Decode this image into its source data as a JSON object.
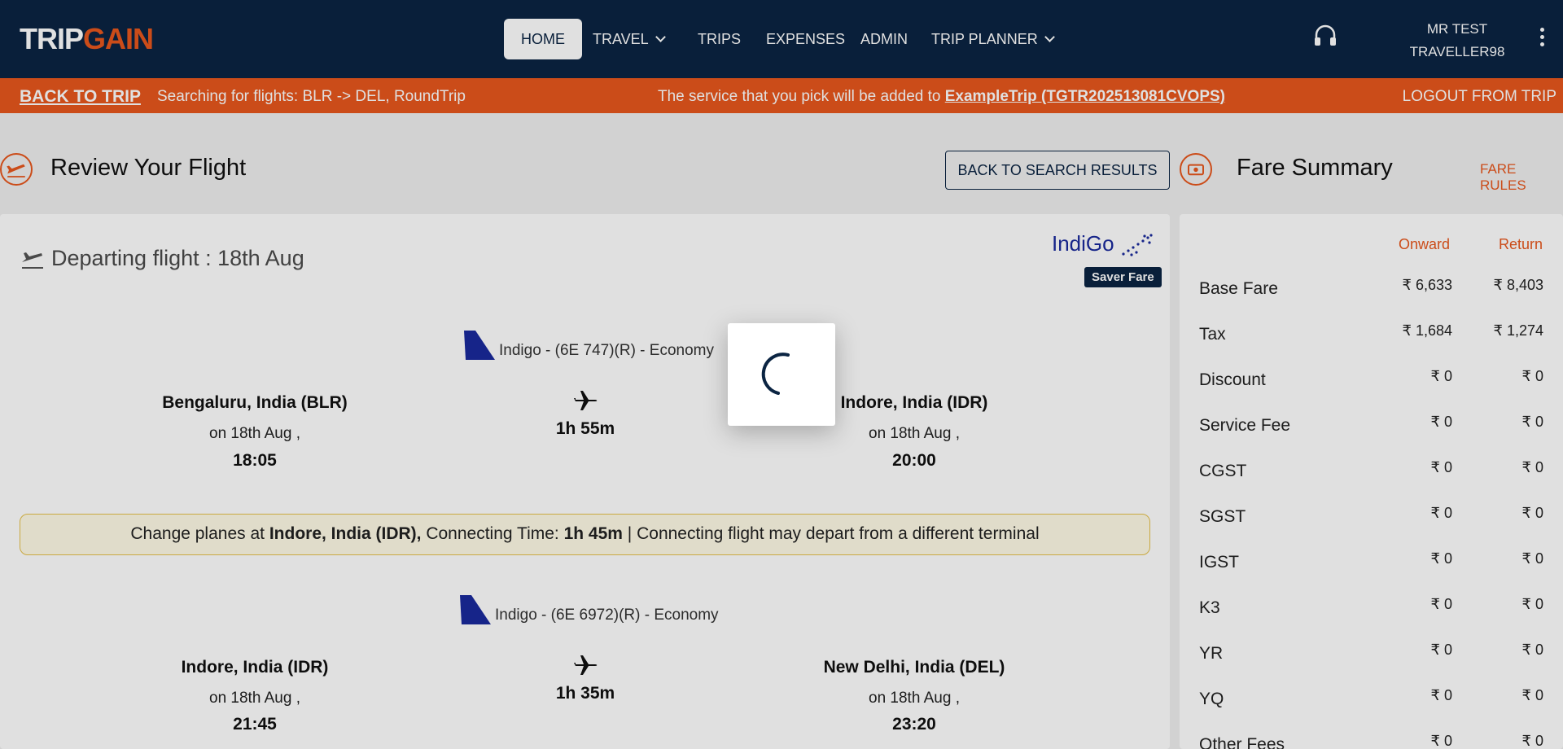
{
  "nav": {
    "logo_trip": "TRIP",
    "logo_gain": "GAIN",
    "home": "HOME",
    "travel": "TRAVEL",
    "trips": "TRIPS",
    "expenses": "EXPENSES",
    "admin": "ADMIN",
    "trip_planner": "TRIP PLANNER",
    "user_line1": "MR TEST",
    "user_line2": "TRAVELLER98"
  },
  "tripbar": {
    "back": "BACK TO TRIP",
    "searching": "Searching for flights: BLR -> DEL, RoundTrip",
    "service_prefix": "The service that you pick will be added to ",
    "service_link": "ExampleTrip (TGTR202513081CVOPS)",
    "logout": "LOGOUT FROM TRIP"
  },
  "review": {
    "title": "Review Your Flight",
    "back_button": "BACK TO SEARCH RESULTS",
    "departing": "Departing flight : 18th Aug",
    "airline_logo": "IndiGo",
    "fare_type": "Saver Fare"
  },
  "segments": [
    {
      "flight": "Indigo - (6E 747)(R) - Economy",
      "from_city": "Bengaluru, India (BLR)",
      "from_date": "on 18th Aug ,",
      "from_time": "18:05",
      "duration": "1h 55m",
      "to_city": "Indore, India (IDR)",
      "to_date": "on 18th Aug ,",
      "to_time": "20:00"
    },
    {
      "flight": "Indigo - (6E 6972)(R) - Economy",
      "from_city": "Indore, India (IDR)",
      "from_date": "on 18th Aug ,",
      "from_time": "21:45",
      "duration": "1h 35m",
      "to_city": "New Delhi, India (DEL)",
      "to_date": "on 18th Aug ,",
      "to_time": "23:20"
    }
  ],
  "layover": {
    "prefix": "Change planes at ",
    "city": "Indore, India (IDR),",
    "conn_label": " Connecting Time: ",
    "conn_time": "1h 45m",
    "suffix": " | Connecting flight may depart from a different terminal"
  },
  "fare": {
    "title": "Fare Summary",
    "rules": "FARE RULES",
    "col_onward": "Onward",
    "col_return": "Return",
    "rows": [
      {
        "label": "Base Fare",
        "onward": "₹ 6,633",
        "return": "₹ 8,403"
      },
      {
        "label": "Tax",
        "onward": "₹ 1,684",
        "return": "₹ 1,274"
      },
      {
        "label": "Discount",
        "onward": "₹ 0",
        "return": "₹ 0"
      },
      {
        "label": "Service Fee",
        "onward": "₹ 0",
        "return": "₹ 0"
      },
      {
        "label": "CGST",
        "onward": "₹ 0",
        "return": "₹ 0"
      },
      {
        "label": "SGST",
        "onward": "₹ 0",
        "return": "₹ 0"
      },
      {
        "label": "IGST",
        "onward": "₹ 0",
        "return": "₹ 0"
      },
      {
        "label": "K3",
        "onward": "₹ 0",
        "return": "₹ 0"
      },
      {
        "label": "YR",
        "onward": "₹ 0",
        "return": "₹ 0"
      },
      {
        "label": "YQ",
        "onward": "₹ 0",
        "return": "₹ 0"
      },
      {
        "label": "Other Fees",
        "onward": "₹ 0",
        "return": "₹ 0"
      }
    ]
  },
  "colors": {
    "navy": "#0b2442",
    "orange": "#e8571d",
    "indigo_blue": "#1a2a9c"
  }
}
